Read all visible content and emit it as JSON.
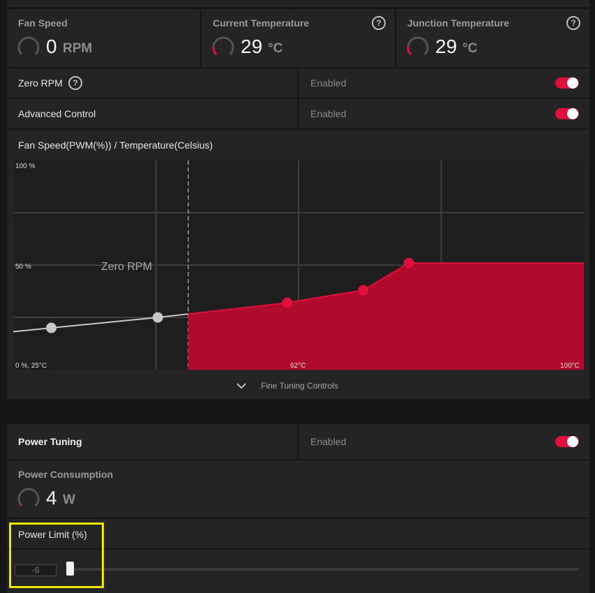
{
  "metrics": {
    "fan_speed": {
      "title": "Fan Speed",
      "value": "0",
      "unit": "RPM"
    },
    "current_temperature": {
      "title": "Current Temperature",
      "value": "29",
      "unit": "°C"
    },
    "junction_temperature": {
      "title": "Junction Temperature",
      "value": "29",
      "unit": "°C"
    }
  },
  "zero_rpm": {
    "label": "Zero RPM",
    "value": "Enabled",
    "enabled": true
  },
  "advanced_control": {
    "label": "Advanced Control",
    "value": "Enabled",
    "enabled": true
  },
  "chart": {
    "heading": "Fan Speed(PWM(%)) / Temperature(Celsius)",
    "zero_rpm_label": "Zero RPM",
    "fine_tuning_label": "Fine Tuning Controls"
  },
  "chart_data": {
    "type": "line",
    "xlabel": "",
    "ylabel": "",
    "tick_labels": {
      "y_top": "100 %",
      "y_mid": "50 %",
      "origin": "0 %, 25°C",
      "x_mid": "62°C",
      "x_right": "100°C"
    },
    "xlim": [
      25,
      100
    ],
    "ylim": [
      0,
      100
    ],
    "zero_rpm_threshold_c": 48,
    "points": [
      {
        "x": 30,
        "y": 20,
        "active": false
      },
      {
        "x": 44,
        "y": 25,
        "active": false
      },
      {
        "x": 61,
        "y": 32,
        "active": true
      },
      {
        "x": 71,
        "y": 38,
        "active": true
      },
      {
        "x": 77,
        "y": 51,
        "active": true
      }
    ],
    "fill_color": "#b00a2d",
    "active_color": "#e0103a",
    "inactive_color": "#c8c8c8",
    "grid": true
  },
  "power_tuning": {
    "label": "Power Tuning",
    "value": "Enabled",
    "enabled": true
  },
  "power_consumption": {
    "title": "Power Consumption",
    "value": "4",
    "unit": "W"
  },
  "power_limit": {
    "label": "Power Limit (%)",
    "value": "-6",
    "slider_fraction": 0.0
  },
  "icons": {
    "help": "question-circle-icon",
    "chevron": "chevron-down-icon",
    "gauge": "gauge-ring-icon"
  }
}
